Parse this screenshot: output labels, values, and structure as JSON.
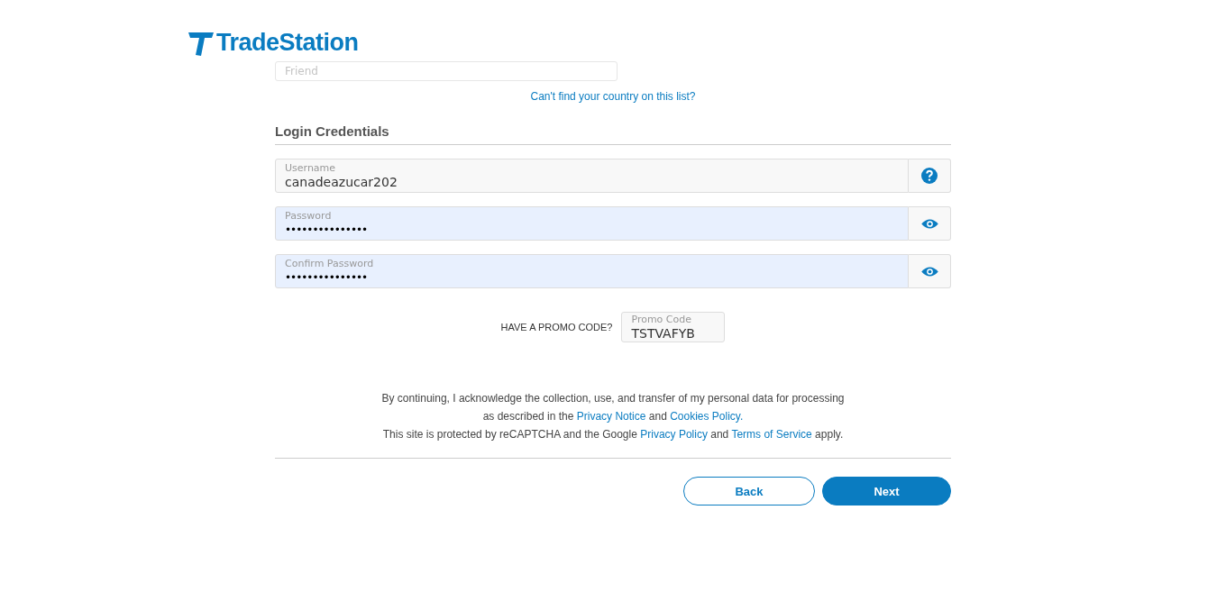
{
  "brand": {
    "name": "TradeStation"
  },
  "referral_field": {
    "placeholder": "Friend"
  },
  "country_link": "Can't find your country on this list?",
  "section_title": "Login Credentials",
  "fields": [
    {
      "label": "Username",
      "value": "canadeazucar202",
      "kind": "help",
      "autofilled": false
    },
    {
      "label": "Password",
      "value": "•••••••••••••••",
      "kind": "reveal",
      "autofilled": true
    },
    {
      "label": "Confirm Password",
      "value": "•••••••••••••••",
      "kind": "reveal",
      "autofilled": true
    }
  ],
  "promo": {
    "prompt": "HAVE A PROMO CODE?",
    "label": "Promo Code",
    "value": "TSTVAFYB"
  },
  "consent": {
    "line1": "By continuing, I acknowledge the collection, use, and transfer of my personal data for processing",
    "line2_prefix": "as described in the",
    "privacy_notice": "Privacy Notice",
    "and1": "and",
    "cookies": "Cookies Policy.",
    "line3_prefix": "This site is protected by reCAPTCHA and the Google",
    "privacy_policy": "Privacy Policy",
    "and2": "and",
    "terms": "Terms of Service",
    "line3_suffix": "apply."
  },
  "buttons": [
    {
      "label": "Back",
      "kind": "secondary"
    },
    {
      "label": "Next",
      "kind": "primary"
    }
  ]
}
